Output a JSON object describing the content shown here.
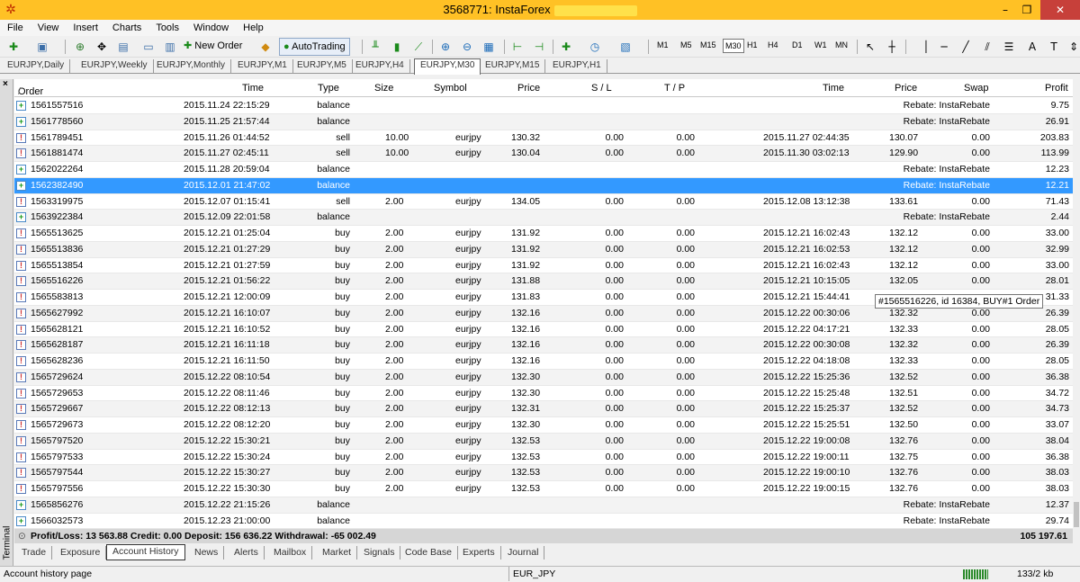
{
  "window": {
    "title": "3568771: InstaForex",
    "close": "✕",
    "minimize": "–",
    "restore": "❐"
  },
  "menu": [
    "File",
    "View",
    "Insert",
    "Charts",
    "Tools",
    "Window",
    "Help"
  ],
  "toolbar": {
    "new_order": "New Order",
    "autotrading": "AutoTrading",
    "timeframes": [
      "M1",
      "M5",
      "M15",
      "M30",
      "H1",
      "H4",
      "D1",
      "W1",
      "MN"
    ],
    "active_timeframe": "M30"
  },
  "chart_tabs": [
    "EURJPY,Daily",
    "EURJPY,Weekly",
    "EURJPY,Monthly",
    "EURJPY,M1",
    "EURJPY,M5",
    "EURJPY,H4",
    "EURJPY,M30",
    "EURJPY,M15",
    "EURJPY,H1"
  ],
  "active_chart_tab": "EURJPY,M30",
  "terminal": {
    "side_label": "Terminal",
    "close_icon": "×",
    "headers": {
      "order": "Order",
      "sort": "/",
      "time": "Time",
      "type": "Type",
      "size": "Size",
      "symbol": "Symbol",
      "price": "Price",
      "sl": "S / L",
      "tp": "T / P",
      "close_time": "Time",
      "close_price": "Price",
      "swap": "Swap",
      "profit": "Profit"
    },
    "rows": [
      {
        "order": "1561557516",
        "time": "2015.11.24 22:15:29",
        "type": "balance",
        "size": "",
        "symbol": "",
        "price": "",
        "sl": "",
        "tp": "",
        "ctime": "",
        "cprice": "",
        "swap": "Rebate: InstaRebate",
        "profit": "9.75"
      },
      {
        "order": "1561778560",
        "time": "2015.11.25 21:57:44",
        "type": "balance",
        "size": "",
        "symbol": "",
        "price": "",
        "sl": "",
        "tp": "",
        "ctime": "",
        "cprice": "",
        "swap": "Rebate: InstaRebate",
        "profit": "26.91"
      },
      {
        "order": "1561789451",
        "time": "2015.11.26 01:44:52",
        "type": "sell",
        "size": "10.00",
        "symbol": "eurjpy",
        "price": "130.32",
        "sl": "0.00",
        "tp": "0.00",
        "ctime": "2015.11.27 02:44:35",
        "cprice": "130.07",
        "swap": "0.00",
        "profit": "203.83"
      },
      {
        "order": "1561881474",
        "time": "2015.11.27 02:45:11",
        "type": "sell",
        "size": "10.00",
        "symbol": "eurjpy",
        "price": "130.04",
        "sl": "0.00",
        "tp": "0.00",
        "ctime": "2015.11.30 03:02:13",
        "cprice": "129.90",
        "swap": "0.00",
        "profit": "113.99"
      },
      {
        "order": "1562022264",
        "time": "2015.11.28 20:59:04",
        "type": "balance",
        "size": "",
        "symbol": "",
        "price": "",
        "sl": "",
        "tp": "",
        "ctime": "",
        "cprice": "",
        "swap": "Rebate: InstaRebate",
        "profit": "12.23"
      },
      {
        "order": "1562382490",
        "time": "2015.12.01 21:47:02",
        "type": "balance",
        "size": "",
        "symbol": "",
        "price": "",
        "sl": "",
        "tp": "",
        "ctime": "",
        "cprice": "",
        "swap": "Rebate: InstaRebate",
        "profit": "12.21"
      },
      {
        "order": "1563319975",
        "time": "2015.12.07 01:15:41",
        "type": "sell",
        "size": "2.00",
        "symbol": "eurjpy",
        "price": "134.05",
        "sl": "0.00",
        "tp": "0.00",
        "ctime": "2015.12.08 13:12:38",
        "cprice": "133.61",
        "swap": "0.00",
        "profit": "71.43"
      },
      {
        "order": "1563922384",
        "time": "2015.12.09 22:01:58",
        "type": "balance",
        "size": "",
        "symbol": "",
        "price": "",
        "sl": "",
        "tp": "",
        "ctime": "",
        "cprice": "",
        "swap": "Rebate: InstaRebate",
        "profit": "2.44"
      },
      {
        "order": "1565513625",
        "time": "2015.12.21 01:25:04",
        "type": "buy",
        "size": "2.00",
        "symbol": "eurjpy",
        "price": "131.92",
        "sl": "0.00",
        "tp": "0.00",
        "ctime": "2015.12.21 16:02:43",
        "cprice": "132.12",
        "swap": "0.00",
        "profit": "33.00"
      },
      {
        "order": "1565513836",
        "time": "2015.12.21 01:27:29",
        "type": "buy",
        "size": "2.00",
        "symbol": "eurjpy",
        "price": "131.92",
        "sl": "0.00",
        "tp": "0.00",
        "ctime": "2015.12.21 16:02:53",
        "cprice": "132.12",
        "swap": "0.00",
        "profit": "32.99"
      },
      {
        "order": "1565513854",
        "time": "2015.12.21 01:27:59",
        "type": "buy",
        "size": "2.00",
        "symbol": "eurjpy",
        "price": "131.92",
        "sl": "0.00",
        "tp": "0.00",
        "ctime": "2015.12.21 16:02:43",
        "cprice": "132.12",
        "swap": "0.00",
        "profit": "33.00"
      },
      {
        "order": "1565516226",
        "time": "2015.12.21 01:56:22",
        "type": "buy",
        "size": "2.00",
        "symbol": "eurjpy",
        "price": "131.88",
        "sl": "0.00",
        "tp": "0.00",
        "ctime": "2015.12.21 10:15:05",
        "cprice": "132.05",
        "swap": "0.00",
        "profit": "28.01"
      },
      {
        "order": "1565583813",
        "time": "2015.12.21 12:00:09",
        "type": "buy",
        "size": "2.00",
        "symbol": "eurjpy",
        "price": "131.83",
        "sl": "0.00",
        "tp": "0.00",
        "ctime": "2015.12.21 15:44:41",
        "cprice": "",
        "swap": "",
        "profit": "31.33"
      },
      {
        "order": "1565627992",
        "time": "2015.12.21 16:10:07",
        "type": "buy",
        "size": "2.00",
        "symbol": "eurjpy",
        "price": "132.16",
        "sl": "0.00",
        "tp": "0.00",
        "ctime": "2015.12.22 00:30:06",
        "cprice": "132.32",
        "swap": "0.00",
        "profit": "26.39"
      },
      {
        "order": "1565628121",
        "time": "2015.12.21 16:10:52",
        "type": "buy",
        "size": "2.00",
        "symbol": "eurjpy",
        "price": "132.16",
        "sl": "0.00",
        "tp": "0.00",
        "ctime": "2015.12.22 04:17:21",
        "cprice": "132.33",
        "swap": "0.00",
        "profit": "28.05"
      },
      {
        "order": "1565628187",
        "time": "2015.12.21 16:11:18",
        "type": "buy",
        "size": "2.00",
        "symbol": "eurjpy",
        "price": "132.16",
        "sl": "0.00",
        "tp": "0.00",
        "ctime": "2015.12.22 00:30:08",
        "cprice": "132.32",
        "swap": "0.00",
        "profit": "26.39"
      },
      {
        "order": "1565628236",
        "time": "2015.12.21 16:11:50",
        "type": "buy",
        "size": "2.00",
        "symbol": "eurjpy",
        "price": "132.16",
        "sl": "0.00",
        "tp": "0.00",
        "ctime": "2015.12.22 04:18:08",
        "cprice": "132.33",
        "swap": "0.00",
        "profit": "28.05"
      },
      {
        "order": "1565729624",
        "time": "2015.12.22 08:10:54",
        "type": "buy",
        "size": "2.00",
        "symbol": "eurjpy",
        "price": "132.30",
        "sl": "0.00",
        "tp": "0.00",
        "ctime": "2015.12.22 15:25:36",
        "cprice": "132.52",
        "swap": "0.00",
        "profit": "36.38"
      },
      {
        "order": "1565729653",
        "time": "2015.12.22 08:11:46",
        "type": "buy",
        "size": "2.00",
        "symbol": "eurjpy",
        "price": "132.30",
        "sl": "0.00",
        "tp": "0.00",
        "ctime": "2015.12.22 15:25:48",
        "cprice": "132.51",
        "swap": "0.00",
        "profit": "34.72"
      },
      {
        "order": "1565729667",
        "time": "2015.12.22 08:12:13",
        "type": "buy",
        "size": "2.00",
        "symbol": "eurjpy",
        "price": "132.31",
        "sl": "0.00",
        "tp": "0.00",
        "ctime": "2015.12.22 15:25:37",
        "cprice": "132.52",
        "swap": "0.00",
        "profit": "34.73"
      },
      {
        "order": "1565729673",
        "time": "2015.12.22 08:12:20",
        "type": "buy",
        "size": "2.00",
        "symbol": "eurjpy",
        "price": "132.30",
        "sl": "0.00",
        "tp": "0.00",
        "ctime": "2015.12.22 15:25:51",
        "cprice": "132.50",
        "swap": "0.00",
        "profit": "33.07"
      },
      {
        "order": "1565797520",
        "time": "2015.12.22 15:30:21",
        "type": "buy",
        "size": "2.00",
        "symbol": "eurjpy",
        "price": "132.53",
        "sl": "0.00",
        "tp": "0.00",
        "ctime": "2015.12.22 19:00:08",
        "cprice": "132.76",
        "swap": "0.00",
        "profit": "38.04"
      },
      {
        "order": "1565797533",
        "time": "2015.12.22 15:30:24",
        "type": "buy",
        "size": "2.00",
        "symbol": "eurjpy",
        "price": "132.53",
        "sl": "0.00",
        "tp": "0.00",
        "ctime": "2015.12.22 19:00:11",
        "cprice": "132.75",
        "swap": "0.00",
        "profit": "36.38"
      },
      {
        "order": "1565797544",
        "time": "2015.12.22 15:30:27",
        "type": "buy",
        "size": "2.00",
        "symbol": "eurjpy",
        "price": "132.53",
        "sl": "0.00",
        "tp": "0.00",
        "ctime": "2015.12.22 19:00:10",
        "cprice": "132.76",
        "swap": "0.00",
        "profit": "38.03"
      },
      {
        "order": "1565797556",
        "time": "2015.12.22 15:30:30",
        "type": "buy",
        "size": "2.00",
        "symbol": "eurjpy",
        "price": "132.53",
        "sl": "0.00",
        "tp": "0.00",
        "ctime": "2015.12.22 19:00:15",
        "cprice": "132.76",
        "swap": "0.00",
        "profit": "38.03"
      },
      {
        "order": "1565856276",
        "time": "2015.12.22 21:15:26",
        "type": "balance",
        "size": "",
        "symbol": "",
        "price": "",
        "sl": "",
        "tp": "",
        "ctime": "",
        "cprice": "",
        "swap": "Rebate: InstaRebate",
        "profit": "12.37"
      },
      {
        "order": "1566032573",
        "time": "2015.12.23 21:00:00",
        "type": "balance",
        "size": "",
        "symbol": "",
        "price": "",
        "sl": "",
        "tp": "",
        "ctime": "",
        "cprice": "",
        "swap": "Rebate: InstaRebate",
        "profit": "29.74"
      }
    ],
    "selected_index": 5,
    "tooltip": "#1565516226, id 16384, BUY#1 Order",
    "summary": {
      "text": "Profit/Loss: 13 563.88  Credit: 0.00  Deposit: 156 636.22  Withdrawal: -65 002.49",
      "total": "105 197.61"
    },
    "tabs": [
      "Trade",
      "Exposure",
      "Account History",
      "News",
      "Alerts",
      "Mailbox",
      "Market",
      "Signals",
      "Code Base",
      "Experts",
      "Journal"
    ],
    "active_tab": "Account History"
  },
  "status": {
    "left": "Account history page",
    "symbol": "EUR_JPY",
    "traffic": "133/2 kb"
  }
}
